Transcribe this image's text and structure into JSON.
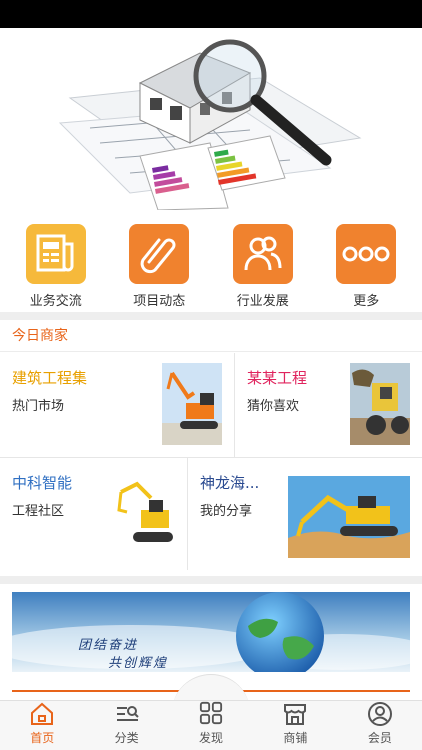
{
  "quick_nav": [
    {
      "label": "业务交流",
      "icon": "newspaper-icon"
    },
    {
      "label": "项目动态",
      "icon": "paperclip-icon"
    },
    {
      "label": "行业发展",
      "icon": "people-icon"
    },
    {
      "label": "更多",
      "icon": "more-dots-icon"
    }
  ],
  "section": {
    "title": "今日商家"
  },
  "merchants": [
    {
      "title": "建筑工程集",
      "subtitle": "热门市场",
      "title_color": "#e8a000"
    },
    {
      "title": "某某工程",
      "subtitle": "猜你喜欢",
      "title_color": "#e0245e"
    },
    {
      "title": "中科智能",
      "subtitle": "工程社区",
      "title_color": "#2f6fc2"
    },
    {
      "title": "神龙海...",
      "subtitle": "我的分享",
      "title_color": "#2a4a90"
    }
  ],
  "banner": {
    "line1": "团结奋进",
    "line2": "共创辉煌"
  },
  "tabbar": [
    {
      "label": "首页",
      "icon": "home-icon",
      "active": true
    },
    {
      "label": "分类",
      "icon": "category-list-icon",
      "active": false
    },
    {
      "label": "发现",
      "icon": "grid-icon",
      "active": false
    },
    {
      "label": "商铺",
      "icon": "store-icon",
      "active": false
    },
    {
      "label": "会员",
      "icon": "user-icon",
      "active": false
    }
  ],
  "colors": {
    "accent": "#e8641a",
    "icon_orange": "#f0822e",
    "icon_yellow": "#f6b93b"
  }
}
